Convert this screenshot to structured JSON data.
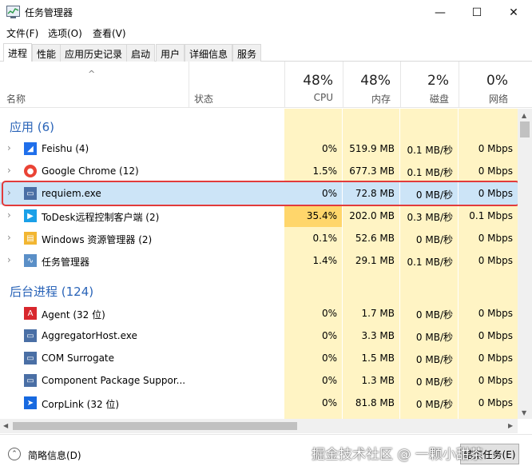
{
  "window": {
    "title": "任务管理器",
    "minimize_glyph": "—",
    "maximize_glyph": "☐",
    "close_glyph": "✕"
  },
  "menu": [
    "文件(F)",
    "选项(O)",
    "查看(V)"
  ],
  "tabs": [
    "进程",
    "性能",
    "应用历史记录",
    "启动",
    "用户",
    "详细信息",
    "服务"
  ],
  "active_tab": "进程",
  "columns": {
    "name": "名称",
    "status": "状态",
    "cpu": {
      "pct": "48%",
      "label": "CPU"
    },
    "memory": {
      "pct": "48%",
      "label": "内存"
    },
    "disk": {
      "pct": "2%",
      "label": "磁盘"
    },
    "network": {
      "pct": "0%",
      "label": "网络"
    }
  },
  "groups": {
    "apps": "应用 (6)",
    "background": "后台进程 (124)"
  },
  "apps": [
    {
      "name": "Feishu (4)",
      "icon": "feishu-icon",
      "cpu": "0%",
      "mem": "519.9 MB",
      "disk": "0.1 MB/秒",
      "net": "0 Mbps"
    },
    {
      "name": "Google Chrome (12)",
      "icon": "chrome-icon",
      "cpu": "1.5%",
      "mem": "677.3 MB",
      "disk": "0.1 MB/秒",
      "net": "0 Mbps"
    },
    {
      "name": "requiem.exe",
      "icon": "window-app-icon",
      "cpu": "0%",
      "mem": "72.8 MB",
      "disk": "0 MB/秒",
      "net": "0 Mbps"
    },
    {
      "name": "ToDesk远程控制客户端 (2)",
      "icon": "todesk-icon",
      "cpu": "35.4%",
      "mem": "202.0 MB",
      "disk": "0.3 MB/秒",
      "net": "0.1 Mbps"
    },
    {
      "name": "Windows 资源管理器 (2)",
      "icon": "explorer-icon",
      "cpu": "0.1%",
      "mem": "52.6 MB",
      "disk": "0 MB/秒",
      "net": "0 Mbps"
    },
    {
      "name": "任务管理器",
      "icon": "taskmgr-icon",
      "cpu": "1.4%",
      "mem": "29.1 MB",
      "disk": "0.1 MB/秒",
      "net": "0 Mbps"
    }
  ],
  "background": [
    {
      "name": "Agent (32 位)",
      "icon": "agent-icon",
      "cpu": "0%",
      "mem": "1.7 MB",
      "disk": "0 MB/秒",
      "net": "0 Mbps"
    },
    {
      "name": "AggregatorHost.exe",
      "icon": "window-app-icon",
      "cpu": "0%",
      "mem": "3.3 MB",
      "disk": "0 MB/秒",
      "net": "0 Mbps"
    },
    {
      "name": "COM Surrogate",
      "icon": "window-app-icon",
      "cpu": "0%",
      "mem": "1.5 MB",
      "disk": "0 MB/秒",
      "net": "0 Mbps"
    },
    {
      "name": "Component Package Suppor...",
      "icon": "window-app-icon",
      "cpu": "0%",
      "mem": "1.3 MB",
      "disk": "0 MB/秒",
      "net": "0 Mbps"
    },
    {
      "name": "CorpLink (32 位)",
      "icon": "corplink-icon",
      "cpu": "0%",
      "mem": "81.8 MB",
      "disk": "0 MB/秒",
      "net": "0 Mbps"
    }
  ],
  "footer": {
    "brief_label": "简略信息(D)",
    "end_task_label": "结束任务(E)",
    "watermark": "掘金技术社区 @ 一颗小甜茶"
  },
  "colors": {
    "cpu_high": "#ffd66b",
    "column_tint": "#fff4c4",
    "selected_row": "#cce4f7",
    "group_text": "#2a64b8",
    "highlight": "#e23b3b"
  }
}
